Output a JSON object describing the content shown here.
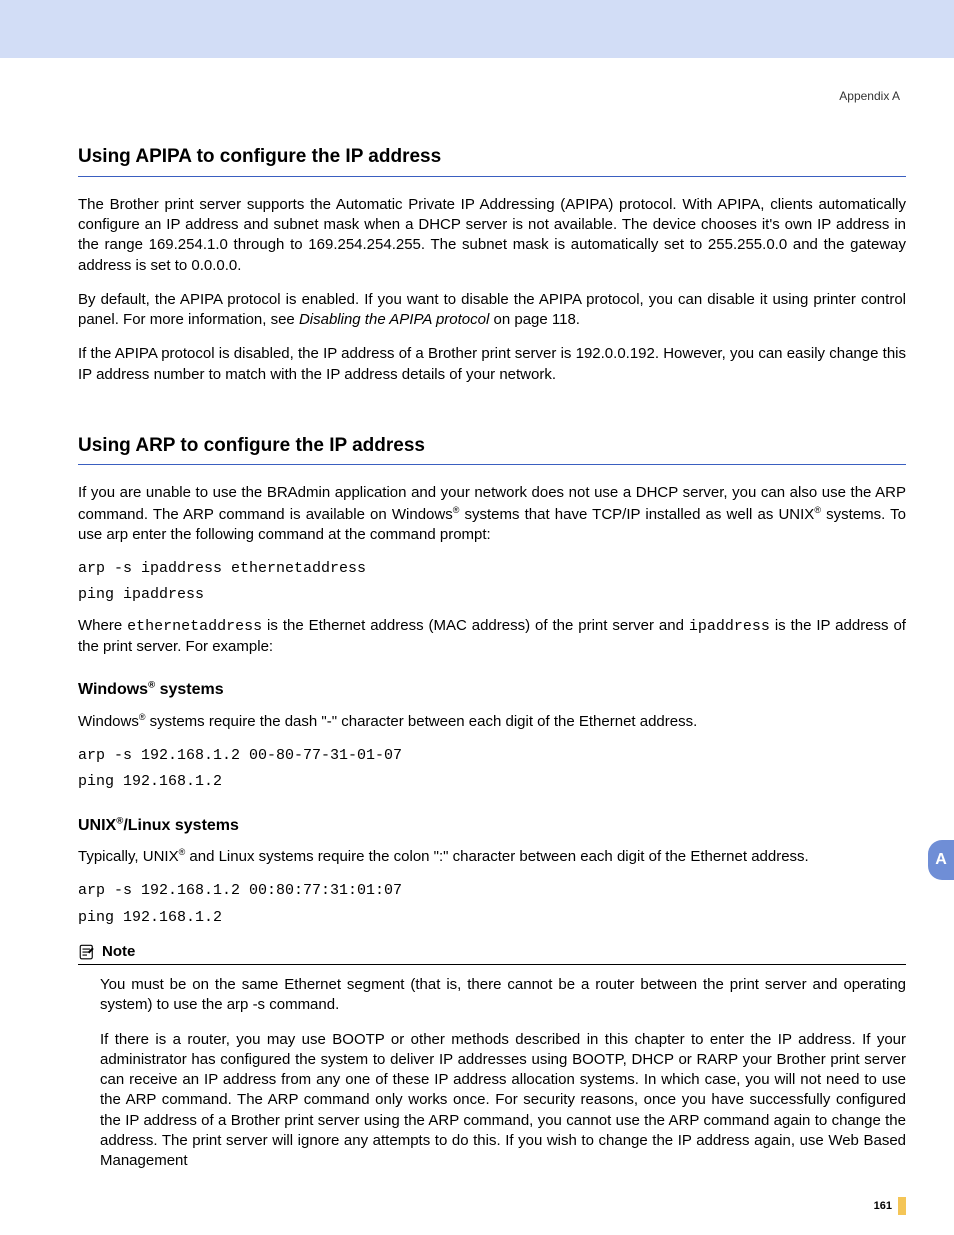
{
  "header": {
    "appendix": "Appendix A"
  },
  "sec1": {
    "title": "Using APIPA to configure the IP address",
    "p1": "The Brother print server supports the Automatic Private IP Addressing (APIPA) protocol. With APIPA, clients automatically configure an IP address and subnet mask when a DHCP server is not available. The device chooses it's own IP address in the range 169.254.1.0 through to 169.254.254.255. The subnet mask is automatically set to 255.255.0.0 and the gateway address is set to 0.0.0.0.",
    "p2a": "By default, the APIPA protocol is enabled. If you want to disable the APIPA protocol, you can disable it using printer control panel. For more information, see ",
    "p2i": "Disabling the APIPA protocol",
    "p2b": " on page 118.",
    "p3": "If the APIPA protocol is disabled, the IP address of a Brother print server is 192.0.0.192. However, you can easily change this IP address number to match with the IP address details of your network."
  },
  "sec2": {
    "title": "Using ARP to configure the IP address",
    "p1a": "If you are unable to use the BRAdmin application and your network does not use a DHCP server, you can also use the ARP command. The ARP command is available on Windows",
    "p1b": " systems that have TCP/IP installed as well as UNIX",
    "p1c": " systems. To use arp enter the following command at the command prompt:",
    "cmd1": "arp -s ipaddress ethernetaddress",
    "cmd2": "ping ipaddress",
    "p2a": "Where ",
    "p2m1": "ethernetaddress",
    "p2b": " is the Ethernet address (MAC address) of the print server and ",
    "p2m2": "ipaddress",
    "p2c": " is the IP address of the print server. For example:"
  },
  "win": {
    "title_a": "Windows",
    "title_b": " systems",
    "p1a": "Windows",
    "p1b": " systems require the dash \"-\" character between each digit of the Ethernet address.",
    "cmd1": "arp -s 192.168.1.2 00-80-77-31-01-07",
    "cmd2": "ping 192.168.1.2"
  },
  "unix": {
    "title_a": "UNIX",
    "title_b": "/Linux systems",
    "p1a": "Typically, UNIX",
    "p1b": " and Linux systems require the colon \":\" character between each digit of the Ethernet address.",
    "cmd1": "arp -s 192.168.1.2 00:80:77:31:01:07",
    "cmd2": "ping 192.168.1.2"
  },
  "note": {
    "label": "Note",
    "p1": "You must be on the same Ethernet segment (that is, there cannot be a router between the print server and operating system) to use the arp -s command.",
    "p2": "If there is a router, you may use BOOTP or other methods described in this chapter to enter the IP address. If your administrator has configured the system to deliver IP addresses using BOOTP, DHCP or RARP your Brother print server can receive an IP address from any one of these IP address allocation systems. In which case, you will not need to use the ARP command. The ARP command only works once. For security reasons, once you have successfully configured the IP address of a Brother print server using the ARP command, you cannot use the ARP command again to change the address. The print server will ignore any attempts to do this. If you wish to change the IP address again, use Web Based Management"
  },
  "sidetab": "A",
  "page_number": "161",
  "reg": "®"
}
